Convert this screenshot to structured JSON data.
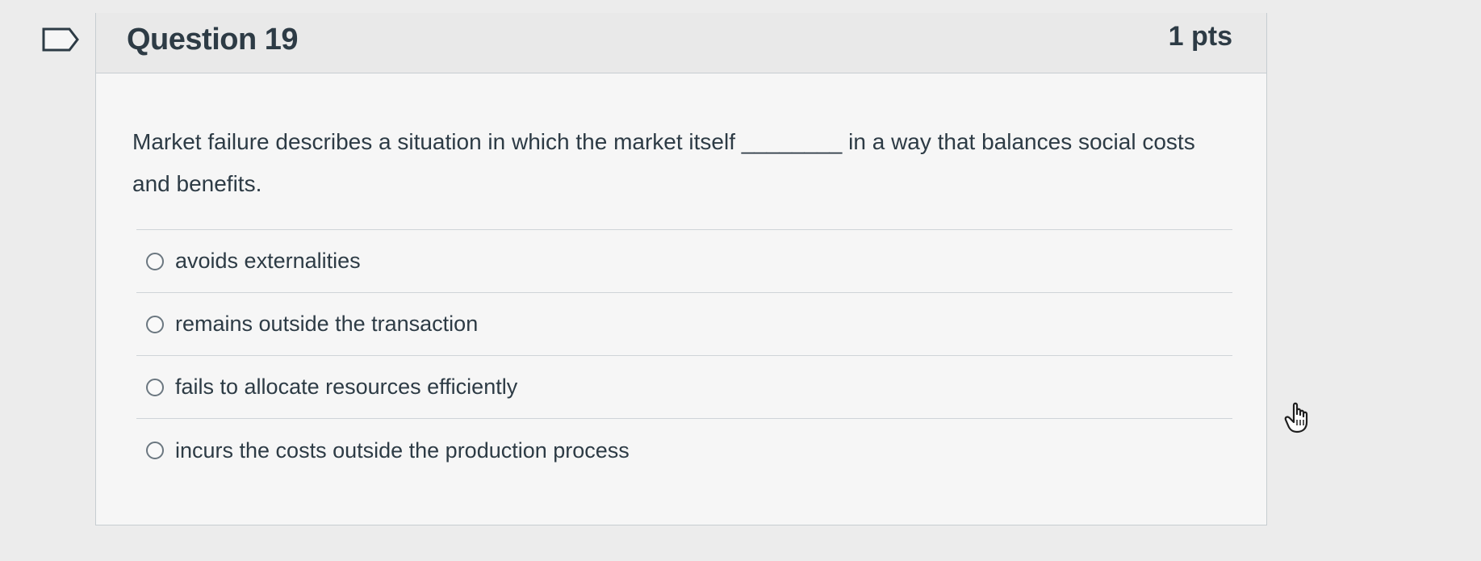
{
  "question": {
    "title": "Question 19",
    "points": "1 pts",
    "text_before_blank": "Market failure describes a situation in which the market itself",
    "blank": "________",
    "text_after_blank": "in a way that balances social costs and benefits."
  },
  "answers": [
    {
      "label": "avoids externalities"
    },
    {
      "label": "remains outside the transaction"
    },
    {
      "label": "fails to allocate resources efficiently"
    },
    {
      "label": "incurs the costs outside the production process"
    }
  ],
  "icons": {
    "flag": "bookmark-flag-icon",
    "cursor": "hand-pointer-icon"
  },
  "colors": {
    "text": "#2d3b45",
    "background": "#ececec",
    "card": "#f6f6f6",
    "header": "#e9e9e9",
    "border": "#c7cdd1"
  }
}
